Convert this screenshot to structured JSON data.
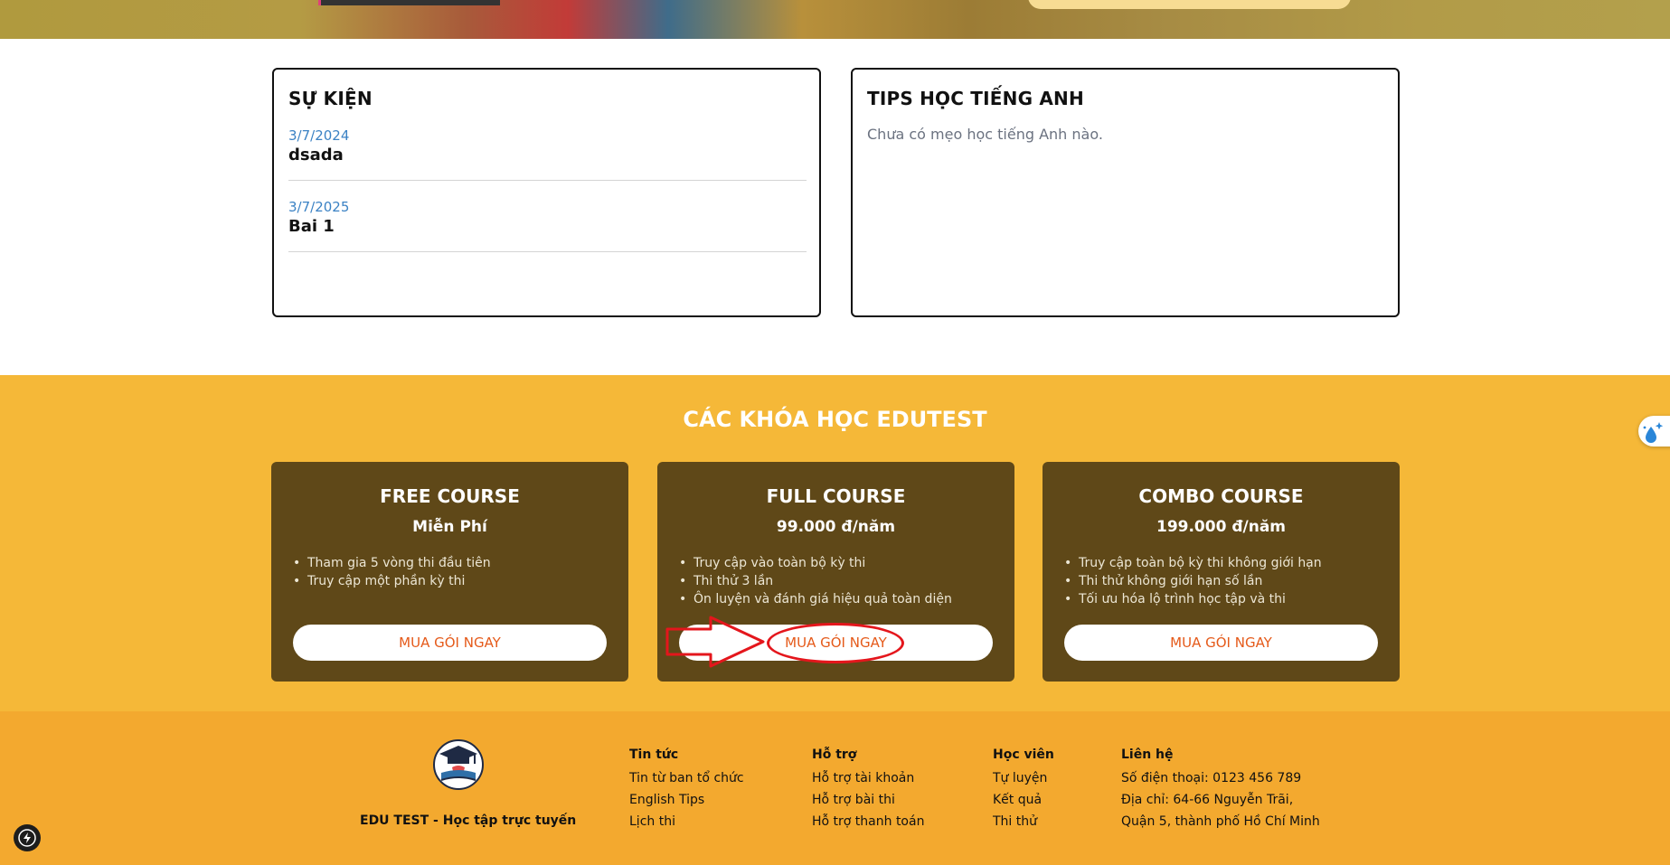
{
  "events": {
    "title": "SỰ KIỆN",
    "items": [
      {
        "date": "3/7/2024",
        "title": "dsada"
      },
      {
        "date": "3/7/2025",
        "title": "Bai 1"
      }
    ]
  },
  "tips": {
    "title": "TIPS HỌC TIẾNG ANH",
    "empty_text": "Chưa có mẹo học tiếng Anh nào."
  },
  "courses": {
    "heading": "CÁC KHÓA HỌC EDUTEST",
    "items": [
      {
        "name": "FREE COURSE",
        "price": "Miễn Phí",
        "features": [
          "Tham gia 5 vòng thi đầu tiên",
          "Truy cập một phần kỳ thi"
        ],
        "button": "MUA GÓI NGAY"
      },
      {
        "name": "FULL COURSE",
        "price": "99.000 đ/năm",
        "features": [
          "Truy cập vào toàn bộ kỳ thi",
          "Thi thử 3 lần",
          "Ôn luyện và đánh giá hiệu quả toàn diện"
        ],
        "button": "MUA GÓI NGAY"
      },
      {
        "name": "COMBO COURSE",
        "price": "199.000 đ/năm",
        "features": [
          "Truy cập toàn bộ kỳ thi không giới hạn",
          "Thi thử không giới hạn số lần",
          "Tối ưu hóa lộ trình học tập và thi"
        ],
        "button": "MUA GÓI NGAY"
      }
    ]
  },
  "footer": {
    "brand_name": "EDU TEST - Học tập trực tuyến",
    "columns": {
      "news": {
        "title": "Tin tức",
        "links": [
          "Tin từ ban tổ chức",
          "English Tips",
          "Lịch thi"
        ]
      },
      "support": {
        "title": "Hỗ trợ",
        "links": [
          "Hỗ trợ tài khoản",
          "Hỗ trợ bài thi",
          "Hỗ trợ thanh toán"
        ]
      },
      "student": {
        "title": "Học viên",
        "links": [
          "Tự luyện",
          "Kết quả",
          "Thi thử"
        ]
      },
      "contact": {
        "title": "Liên hệ",
        "lines": [
          "Số điện thoại: 0123 456 789",
          "Địa chỉ: 64-66 Nguyễn Trãi,",
          "Quận 5, thành phố Hồ Chí Minh"
        ]
      }
    }
  },
  "colors": {
    "courses_bg": "#f5b838",
    "course_card_bg": "#5f4818",
    "footer_bg": "#f3a92f",
    "button_text": "#e55a1a",
    "event_date": "#3b82c4",
    "annotation": "#e4161c"
  },
  "icons": {
    "logo": "graduation-cap-book-icon",
    "side_widget": "sparkle-drop-icon",
    "fab": "lightning-icon"
  }
}
